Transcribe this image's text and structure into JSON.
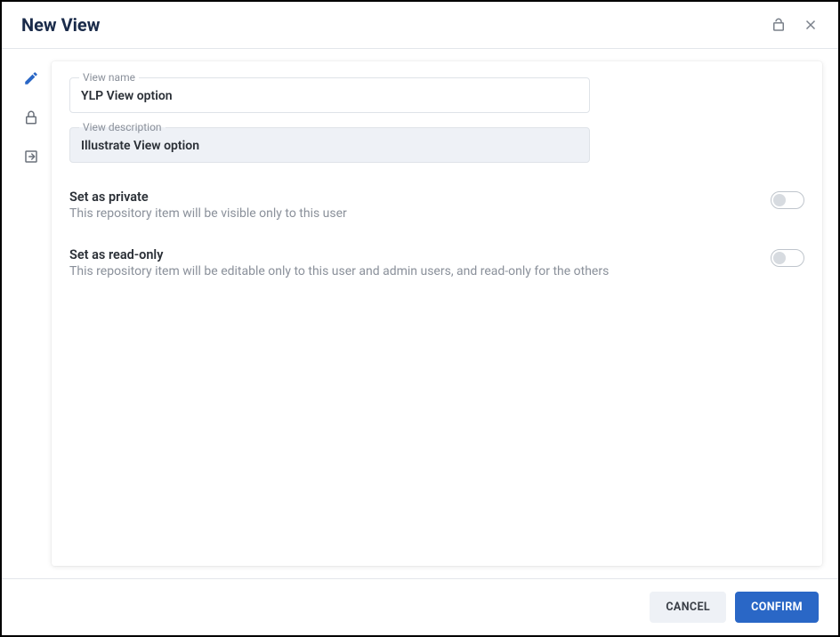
{
  "header": {
    "title": "New View"
  },
  "fields": {
    "name_label": "View name",
    "name_value": "YLP View option",
    "desc_label": "View description",
    "desc_value": "Illustrate View option"
  },
  "settings": {
    "private_title": "Set as private",
    "private_desc": "This repository item will be visible only to this user",
    "readonly_title": "Set as read-only",
    "readonly_desc": "This repository item will be editable only to this user and admin users, and read-only for the others"
  },
  "footer": {
    "cancel_label": "CANCEL",
    "confirm_label": "CONFIRM"
  }
}
